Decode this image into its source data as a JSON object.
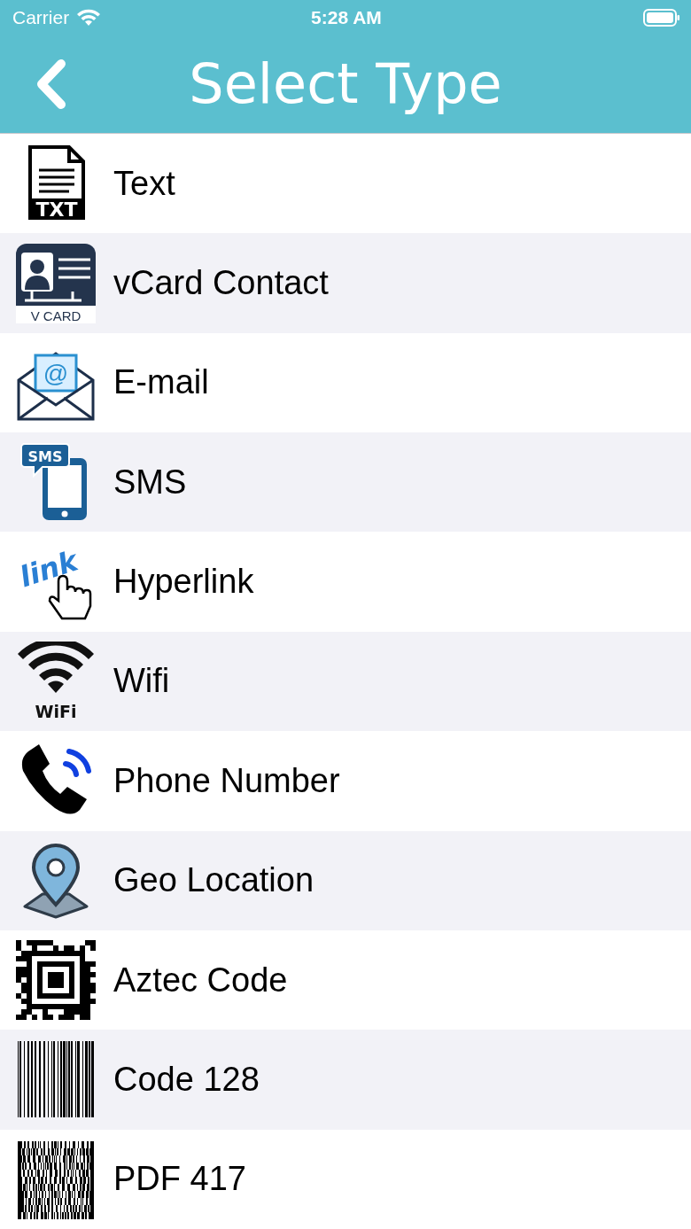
{
  "status_bar": {
    "carrier": "Carrier",
    "time": "5:28 AM"
  },
  "nav_bar": {
    "title": "Select Type"
  },
  "types": [
    {
      "label": "Text",
      "kind": "text",
      "icon_label": "TXT"
    },
    {
      "label": "vCard Contact",
      "kind": "vcard",
      "icon_label": "V CARD"
    },
    {
      "label": "E-mail",
      "kind": "email",
      "icon_label": "@"
    },
    {
      "label": "SMS",
      "kind": "sms",
      "icon_label": "SMS"
    },
    {
      "label": "Hyperlink",
      "kind": "link",
      "icon_label": "link"
    },
    {
      "label": "Wifi",
      "kind": "wifi",
      "icon_label": "WiFi"
    },
    {
      "label": "Phone Number",
      "kind": "phone"
    },
    {
      "label": "Geo Location",
      "kind": "geo"
    },
    {
      "label": "Aztec Code",
      "kind": "aztec"
    },
    {
      "label": "Code 128",
      "kind": "code128"
    },
    {
      "label": "PDF 417",
      "kind": "pdf417"
    }
  ]
}
